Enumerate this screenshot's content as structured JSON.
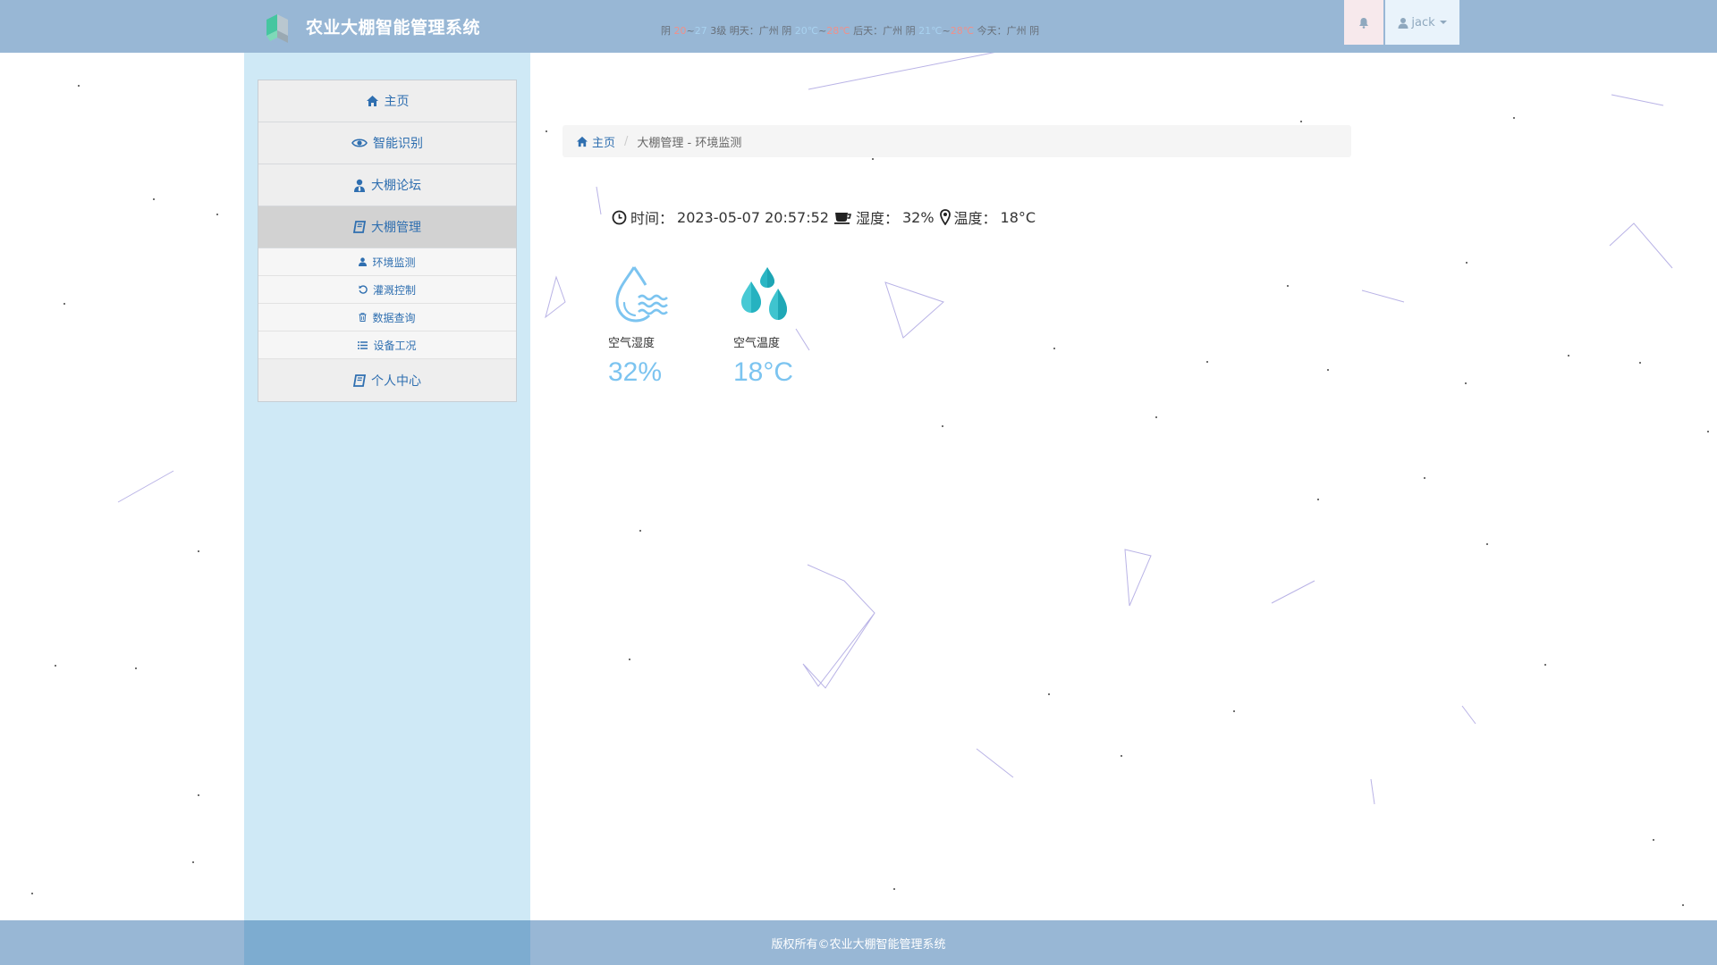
{
  "header": {
    "title": "农业大棚智能管理系统",
    "ticker": [
      {
        "t": "阴 "
      },
      {
        "t": "20",
        "c": "hot"
      },
      {
        "t": "~"
      },
      {
        "t": "27",
        "c": "cold"
      },
      {
        "t": " 3级 明天：广州 阴 "
      },
      {
        "t": "20℃",
        "c": "cold"
      },
      {
        "t": "~"
      },
      {
        "t": "28℃",
        "c": "hot"
      },
      {
        "t": " 后天：广州 阴 "
      },
      {
        "t": "21℃",
        "c": "cold"
      },
      {
        "t": "~"
      },
      {
        "t": "28℃",
        "c": "hot"
      },
      {
        "t": " 今天：广州 阴"
      }
    ],
    "user_name": "jack"
  },
  "sidebar": {
    "items": [
      {
        "label": "主页",
        "icon": "home-icon"
      },
      {
        "label": "智能识别",
        "icon": "eye-icon"
      },
      {
        "label": "大棚论坛",
        "icon": "user-tie-icon"
      },
      {
        "label": "大棚管理",
        "icon": "book-icon",
        "active": true,
        "children": [
          {
            "label": "环境监测",
            "icon": "user-icon"
          },
          {
            "label": "灌溉控制",
            "icon": "refresh-icon"
          },
          {
            "label": "数据查询",
            "icon": "trash-icon"
          },
          {
            "label": "设备工况",
            "icon": "list-icon"
          }
        ]
      },
      {
        "label": "个人中心",
        "icon": "book-icon"
      }
    ]
  },
  "breadcrumb": {
    "home": "主页",
    "current": "大棚管理 - 环境监测"
  },
  "status": {
    "time_label": "时间：",
    "time_value": "2023-05-07 20:57:52",
    "humidity_label": "湿度：",
    "humidity_value": "32%",
    "temp_label": "温度：",
    "temp_value": "18°C"
  },
  "cards": [
    {
      "label": "空气湿度",
      "value": "32%",
      "icon": "water-drop-waves-icon"
    },
    {
      "label": "空气温度",
      "value": "18°C",
      "icon": "water-drops-icon"
    }
  ],
  "footer": {
    "text": "版权所有©农业大棚智能管理系统"
  },
  "colors": {
    "header": "#98b7d5",
    "sidebar": "#cfe9f6",
    "link": "#2f6fb0",
    "value": "#7cc4f0"
  }
}
